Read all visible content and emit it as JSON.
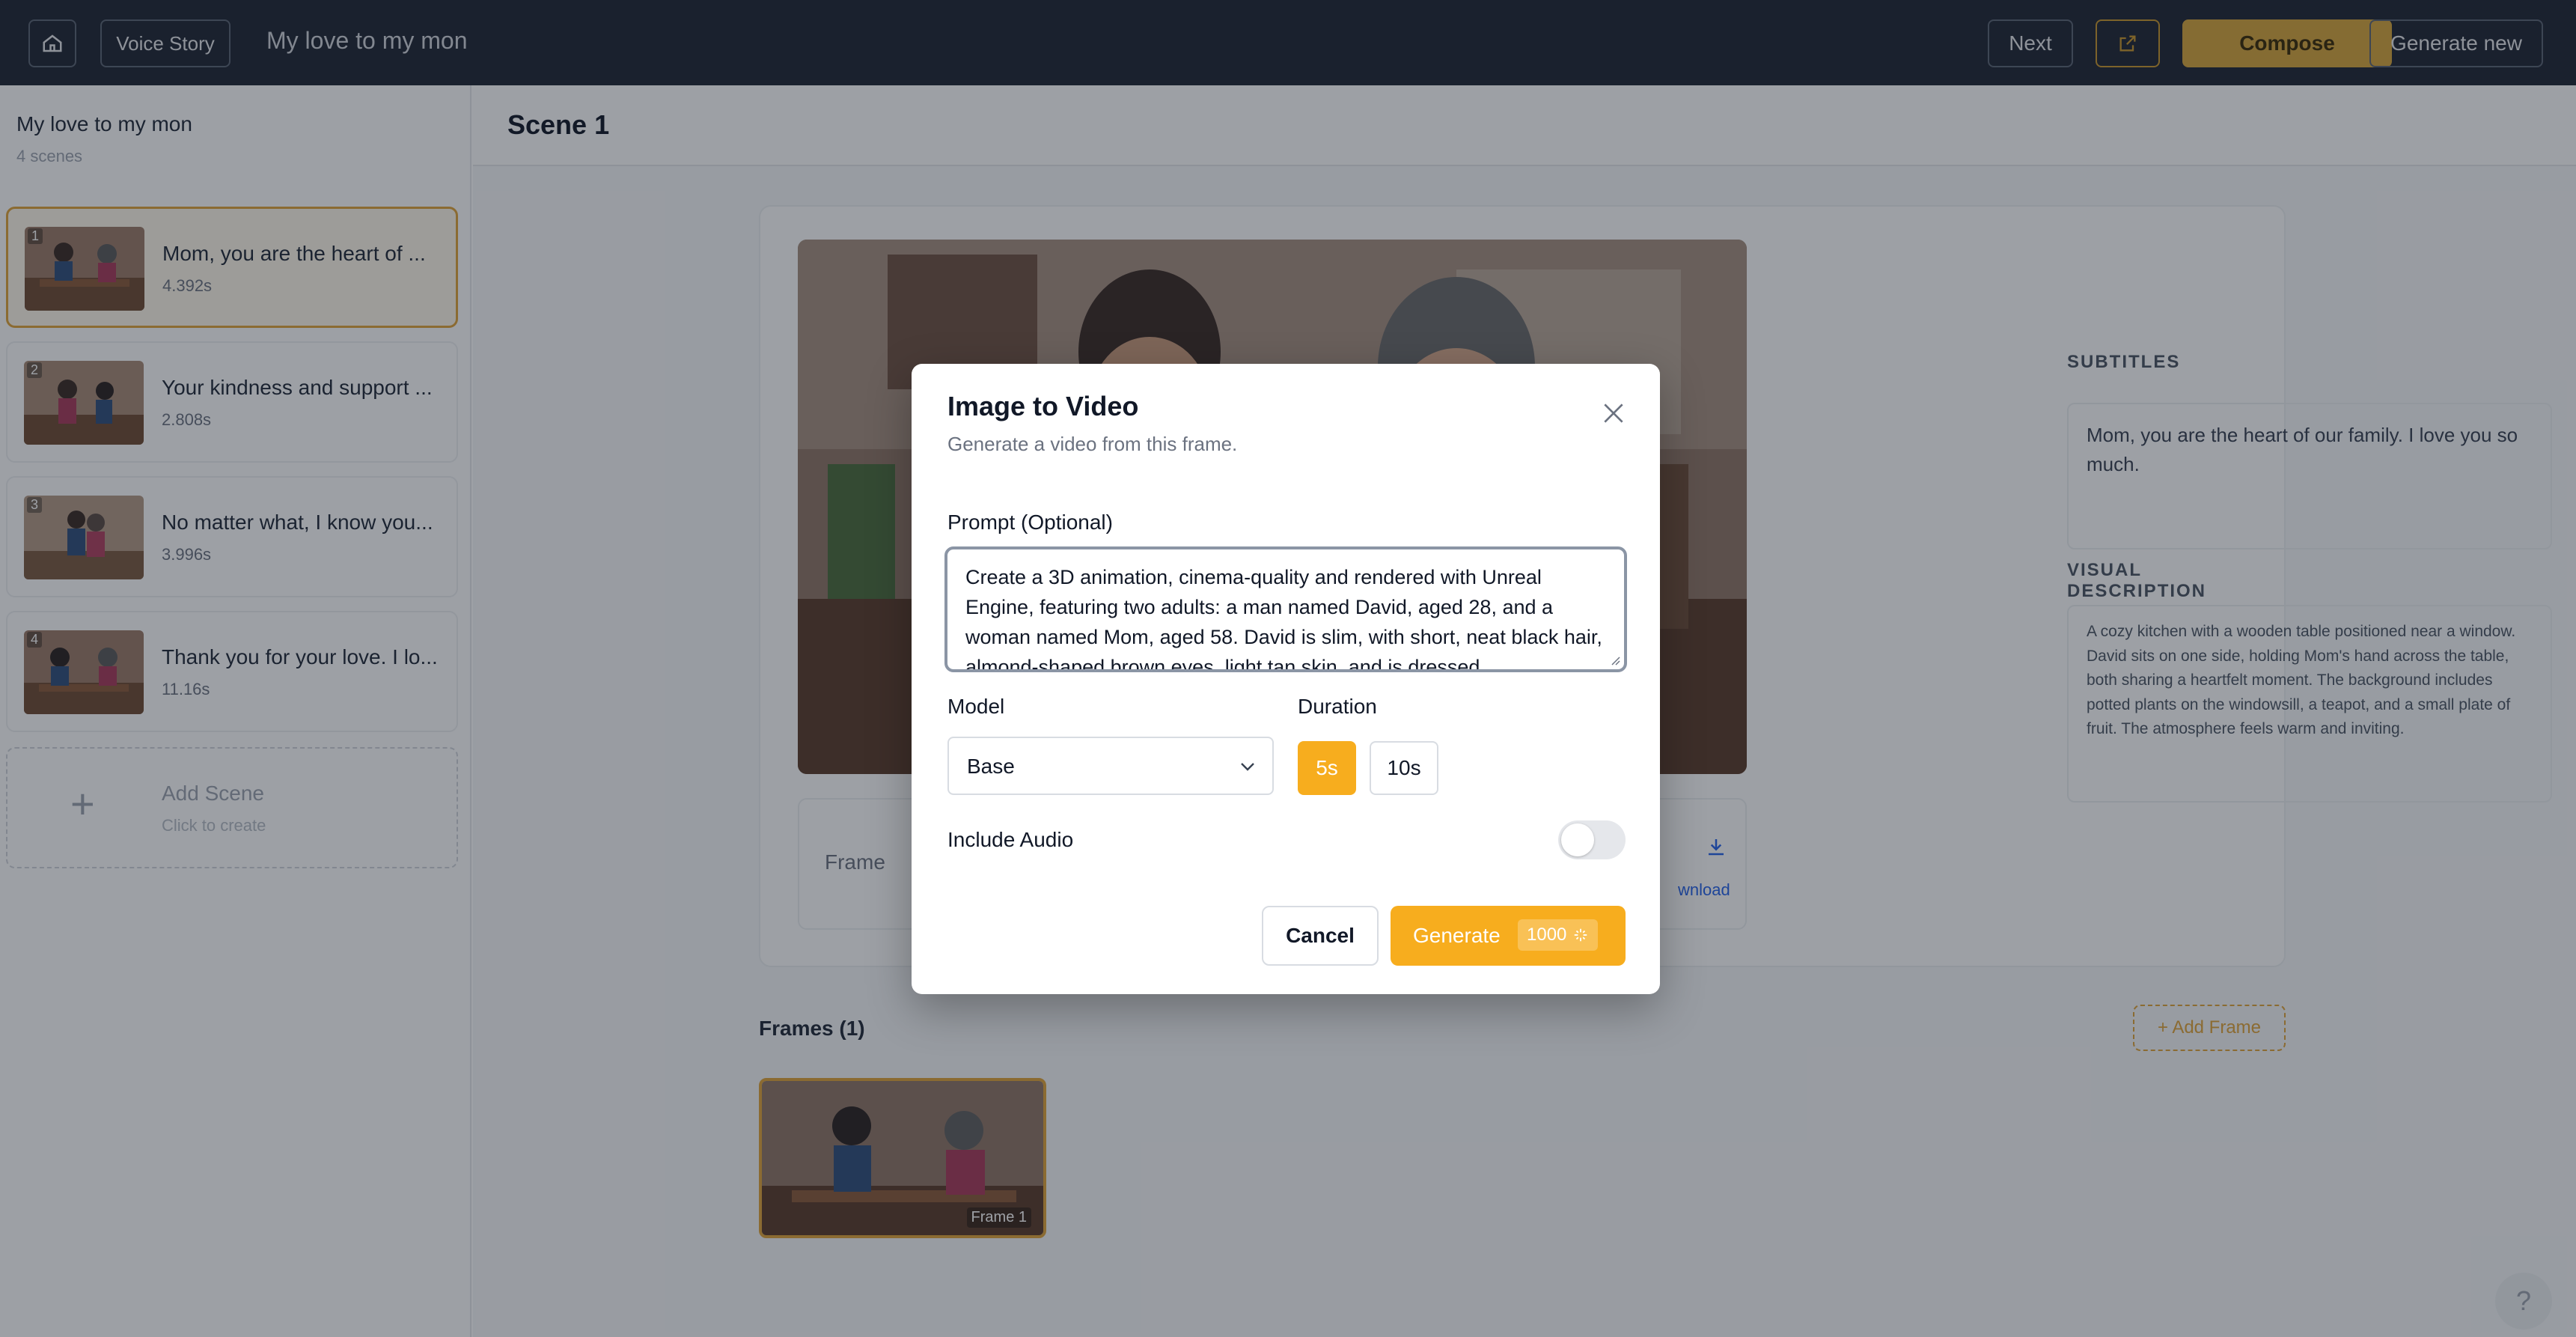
{
  "header": {
    "home_icon": "home-icon",
    "voice_story_label": "Voice Story",
    "project_title": "My love to my mon",
    "next_label": "Next",
    "external_icon": "external-link-icon",
    "compose_label": "Compose",
    "generate_new_label": "Generate new",
    "accent_color": "#d6a53c"
  },
  "sidebar": {
    "title": "My love to my mon",
    "scene_count": "4 scenes",
    "scenes": [
      {
        "num": "1",
        "text": "Mom, you are the heart of ...",
        "duration": "4.392s"
      },
      {
        "num": "2",
        "text": "Your kindness and support ...",
        "duration": "2.808s"
      },
      {
        "num": "3",
        "text": "No matter what, I know you...",
        "duration": "3.996s"
      },
      {
        "num": "4",
        "text": "Thank you for your love. I lo...",
        "duration": "11.16s"
      }
    ],
    "add_scene": {
      "title": "Add Scene",
      "subtitle": "Click to create"
    }
  },
  "scene": {
    "title": "Scene 1",
    "frame_label": "Frame",
    "download_label": "wnload",
    "subtitles_label": "SUBTITLES",
    "subtitles_text": "Mom, you are the heart of our family. I love you so much.",
    "visual_label": "VISUAL DESCRIPTION",
    "visual_text": "A cozy kitchen with a wooden table positioned near a window. David sits on one side, holding Mom's hand across the table, both sharing a heartfelt moment. The background includes potted plants on the windowsill, a teapot, and a small plate of fruit. The atmosphere feels warm and inviting.",
    "frames_title": "Frames (1)",
    "add_frame_label": "+ Add Frame",
    "frame_thumb_label": "Frame 1"
  },
  "help_label": "?",
  "modal": {
    "title": "Image to Video",
    "subtitle": "Generate a video from this frame.",
    "prompt_label": "Prompt (Optional)",
    "prompt_value": "Create a 3D animation, cinema-quality and rendered with Unreal Engine, featuring two adults: a man named David, aged 28, and a woman named Mom, aged 58. David is slim, with short, neat black hair, almond-shaped brown eyes, light tan skin, and is dressed",
    "model_label": "Model",
    "model_value": "Base",
    "duration_label": "Duration",
    "duration_options": [
      "5s",
      "10s"
    ],
    "duration_selected": "5s",
    "audio_label": "Include Audio",
    "audio_enabled": false,
    "cancel_label": "Cancel",
    "generate_label": "Generate",
    "generate_cost": "1000",
    "primary_color": "#f7ad1e"
  }
}
